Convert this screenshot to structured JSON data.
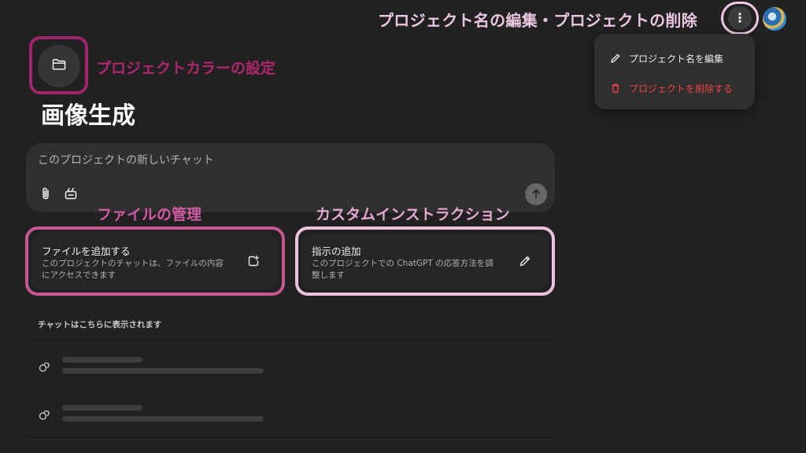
{
  "annotations": {
    "project_name_menu": "プロジェクト名の編集・プロジェクトの削除",
    "project_color": "プロジェクトカラーの設定",
    "file_management": "ファイルの管理",
    "custom_instruction": "カスタムインストラクション"
  },
  "header": {
    "more_icon": "vertical-ellipsis-icon",
    "more_glyph": "⋮",
    "avatar_icon": "user-avatar"
  },
  "menu": {
    "items": [
      {
        "label": "プロジェクト名を編集",
        "icon": "pencil-icon"
      },
      {
        "label": "プロジェクトを削除する",
        "icon": "trash-icon",
        "color": "#ef4444"
      }
    ]
  },
  "project": {
    "folder_icon": "folder-icon",
    "title": "画像生成"
  },
  "composer": {
    "placeholder": "このプロジェクトの新しいチャット",
    "attach_icon": "paperclip-icon",
    "tools_icon": "tools-icon",
    "send_icon": "arrow-up-icon"
  },
  "cards": {
    "files": {
      "title": "ファイルを追加する",
      "description": "このプロジェクトのチャットは、ファイルの内容にアクセスできます",
      "icon": "add-file-icon"
    },
    "instructions": {
      "title": "指示の追加",
      "description": "このプロジェクトでの ChatGPT の応答方法を調整します",
      "icon": "pencil-icon"
    }
  },
  "chats": {
    "section_label": "チャットはこちらに表示されます",
    "placeholder_rows": 2,
    "row_icon": "chat-bubbles-icon"
  },
  "colors": {
    "background": "#212121",
    "annotation_magenta": "#b0266f",
    "annotation_pink": "#d25aa6",
    "annotation_light_pink": "#ecc6e1",
    "danger": "#ef4444"
  }
}
